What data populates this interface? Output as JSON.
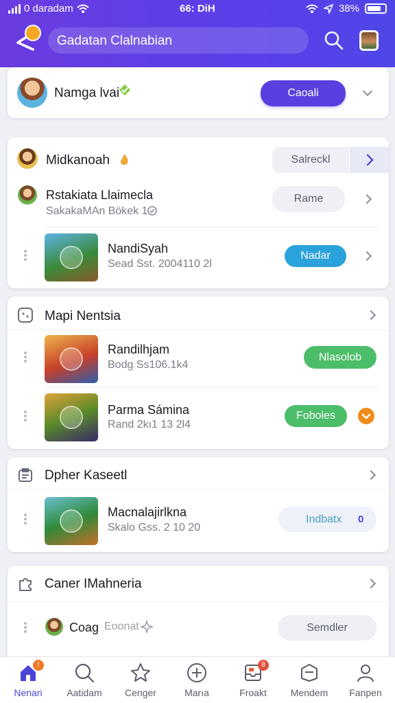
{
  "status_bar": {
    "carrier": "0 daradam",
    "time": "66: DiH",
    "battery": "38%"
  },
  "header": {
    "search_text": "Gadatan Clalnabian"
  },
  "account_card": {
    "name": "Namga lvai",
    "primary_button": "Caoali"
  },
  "group1": {
    "header": {
      "title": "Midkanoah",
      "button": "Salreckl"
    },
    "items": [
      {
        "title": "Rstakiata Llaimecla",
        "subtitle": "SakakaMAn Bökek 1",
        "button": "Rame"
      },
      {
        "title": "NandiSyah",
        "subtitle": "Sead Sst. 2004110 2l",
        "button": "Nadar"
      }
    ]
  },
  "group2": {
    "title": "Mapi Nentsia",
    "items": [
      {
        "title": "Randilhjam",
        "subtitle": "Bodg Ss106.1k4",
        "button": "Nlasolob"
      },
      {
        "title": "Parma Sámina",
        "subtitle": "Rand 2kı1 13 2l4",
        "button": "Foboles"
      }
    ]
  },
  "group3": {
    "title": "Dpher Kaseetl",
    "items": [
      {
        "title": "Macnalajirlkna",
        "subtitle": "Skalo Gss. 2 10 20",
        "button": "Indbatx",
        "badge": "0"
      }
    ]
  },
  "group4": {
    "title": "Caner IMahneria",
    "items": [
      {
        "title": "Coag",
        "subtitle": "Eoonat",
        "button": "Semdler"
      }
    ]
  },
  "bottom_nav": {
    "items": [
      {
        "label": "Nenari",
        "icon": "home-icon",
        "badge": "!"
      },
      {
        "label": "Aatidam",
        "icon": "search-icon"
      },
      {
        "label": "Cenger",
        "icon": "star-icon"
      },
      {
        "label": "Marıa",
        "icon": "plus-circle-icon"
      },
      {
        "label": "Froakt",
        "icon": "inbox-icon",
        "badge": "8"
      },
      {
        "label": "Mendem",
        "icon": "chat-icon"
      },
      {
        "label": "Fanpen",
        "icon": "profile-icon"
      }
    ]
  },
  "colors": {
    "accent": "#5a3fe0",
    "header": "#5b3fe8",
    "green": "#4cbd69",
    "blue": "#2aa2db",
    "orange": "#f07a2a"
  }
}
